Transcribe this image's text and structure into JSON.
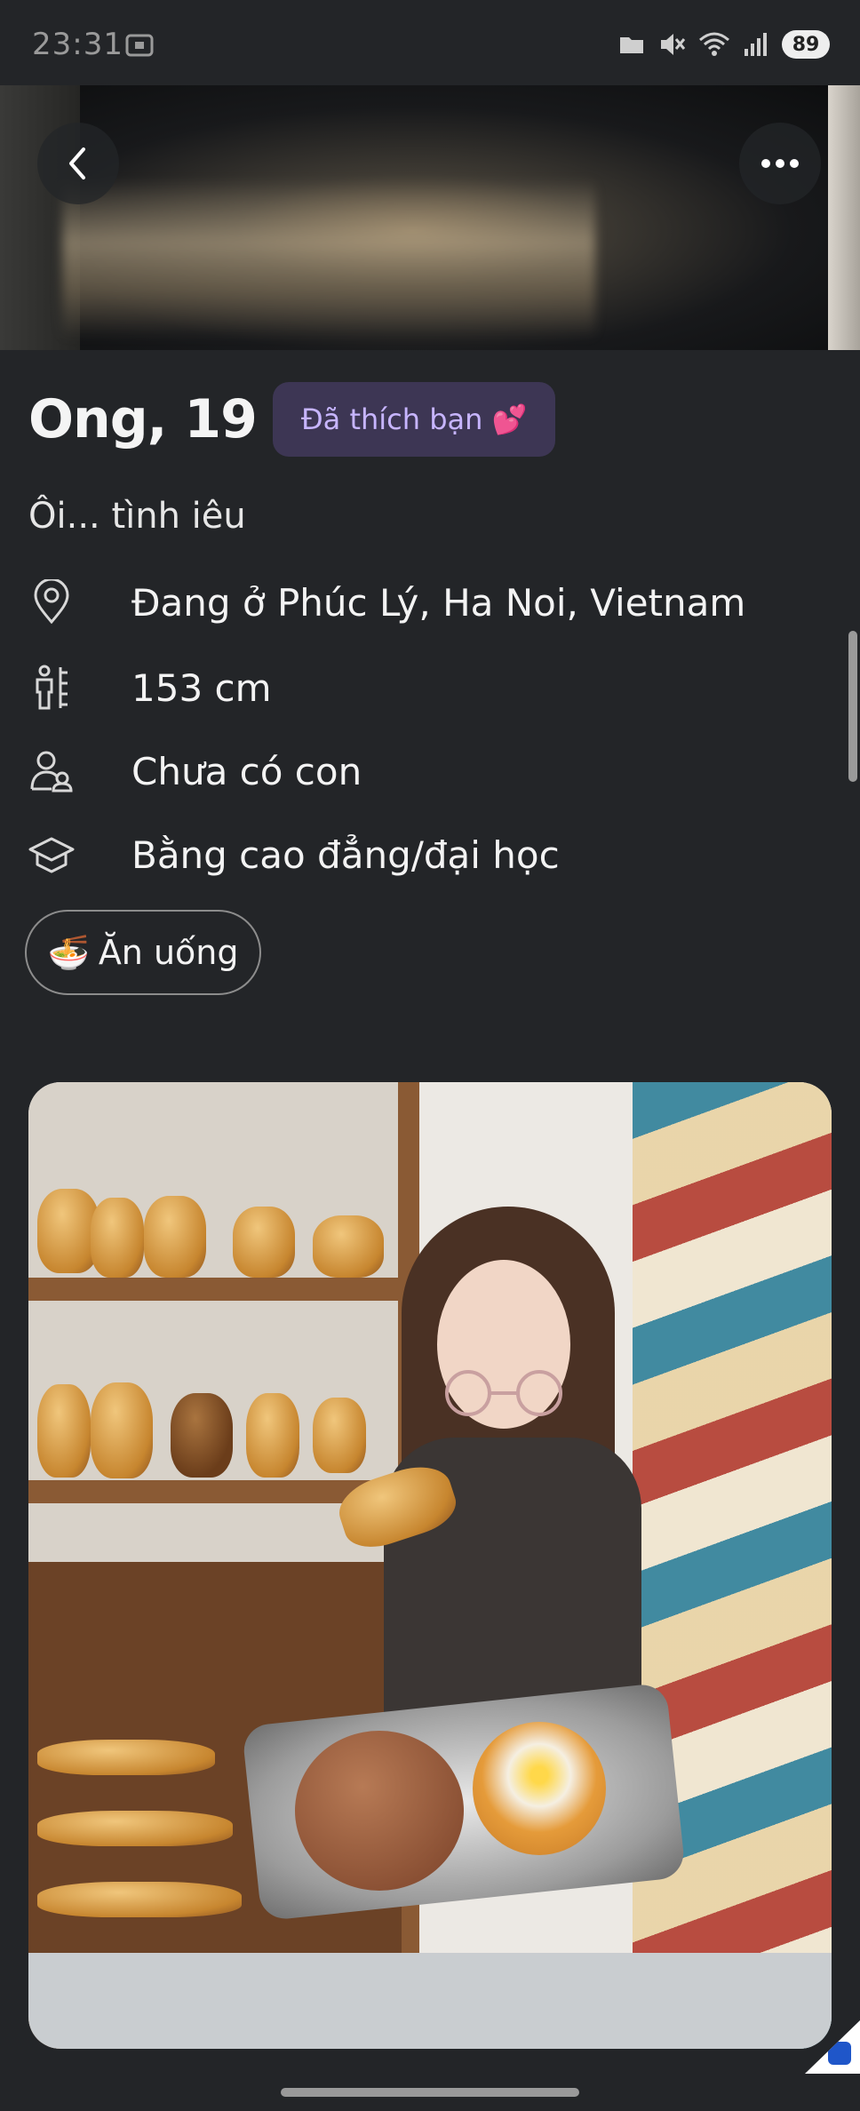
{
  "status_bar": {
    "time": "23:31",
    "battery": "89",
    "icons": [
      "screenshot-icon",
      "folder-icon",
      "mute-icon",
      "wifi-icon",
      "signal-icon",
      "battery-icon"
    ]
  },
  "header": {
    "back_icon": "chevron-left-icon",
    "more_icon": "more-horizontal-icon"
  },
  "profile": {
    "name_age": "Ong, 19",
    "liked_badge": "Đã thích bạn 💕",
    "tagline": "Ôi... tình iêu",
    "details": [
      {
        "icon": "location-pin-icon",
        "text": "Đang ở Phúc Lý, Ha Noi, Vietnam"
      },
      {
        "icon": "height-icon",
        "text": "153 cm"
      },
      {
        "icon": "children-icon",
        "text": "Chưa có con"
      },
      {
        "icon": "education-cap-icon",
        "text": "Bằng cao đẳng/đại học"
      }
    ],
    "interest": {
      "emoji": "🍜",
      "label": "Ăn uống"
    }
  },
  "colors": {
    "background": "#232528",
    "badge_bg": "#3d3654",
    "badge_text": "#c7b5ff"
  }
}
